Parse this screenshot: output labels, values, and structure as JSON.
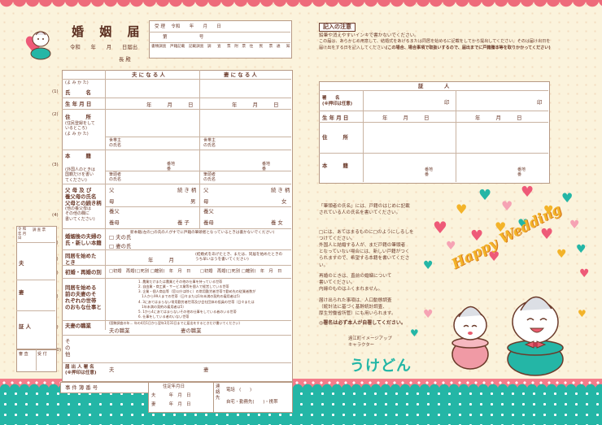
{
  "header": {
    "title": "婚 姻 届",
    "date_line": "令和　　年　　月　　日届出",
    "addressee": "長 殿"
  },
  "reception": {
    "row1": "受 理 　令和　　年　　月　　日",
    "row1b": "発 送　令和　　年　　月　　日",
    "row2": "第　　　　　　　号",
    "cols": [
      "書類調査",
      "戸籍記載",
      "記載調査",
      "調 査 票",
      "附　　票",
      "住 民 票",
      "通　知"
    ]
  },
  "rows": {
    "furigana": "(よ み か た)",
    "husband": "夫 に な る 人",
    "wife": "妻 に な る 人",
    "name": "氏　　　名",
    "birth": "生 年 月 日",
    "ymd": "年　　　月　　　日",
    "address": "住　　　所",
    "address_sub": "(住民登録をして\nいるところ)",
    "householder": "世帯主\nの氏名",
    "honseki": "本　　　籍",
    "honseki_sub": "(外国人のときは\n国籍だけを書い\nてください)",
    "banchi": "番地\n番",
    "hittou": "筆頭者\nの氏名",
    "parents": "父 母 及 び\n養父母の氏名\n父母との続き柄",
    "parents_sub": "(他の養父母は\nその他の欄に\n書いてください)",
    "father": "父",
    "mother": "母",
    "adopt_f": "養父",
    "adopt_m": "養母",
    "rel": "続 き 柄",
    "son": "男",
    "daughter": "女",
    "adopt_son": "養 子",
    "adopt_dau": "養 女",
    "new_name": "婚姻後の夫婦の\n氏・新しい本籍",
    "new_name_opt": "□ 夫の氏\n□ 妻の氏",
    "new_name_note": "新本籍(左の□の氏の人がすでに戸籍の筆頭者となっているときは書かないでください)",
    "cohab": "同居を始めた\nとき",
    "cohab_val": "年　　　月",
    "cohab_note": "(結婚式をあげたとき、または、同居を始めたときの\nうち早いほうを書いてください)",
    "prev": "初婚・再婚の別",
    "prev_val": "□初婚　再婚(□死別 □離別)　年　月　日",
    "work": "同居を始める\n前の夫妻のそ\nれぞれの世帯\nのおもな仕事と",
    "work_items": [
      "1. 農業だけまたは農業とその他の仕事を持っている世帯",
      "2. 自由業・商工業・サービス業等を個人で経営している世帯",
      "3. 企業・個人商店等（官公庁は除く）の常用勤労者世帯で勤め先の従業者数が",
      "　1人から99人までの世帯（日々または1年未満の契約の雇用者は5）",
      "4. 3にあてはまらない常用勤労者世帯及び会社団体の役員の世帯（日々または",
      "　1年未満の契約の雇用者は5）",
      "5. 1から4にあてはまらないその他の仕事をしている者のいる世帯",
      "6. 仕事をしている者のいない世帯"
    ],
    "job": "夫妻の職業",
    "job_sub": "(国勢調査の年… 年の4月1日から翌年3月31日までに届出をするときだけ書いてください)",
    "job_h": "夫の職業",
    "job_w": "妻の職業",
    "other": "そ\nの\n他",
    "signature": "届 出 人 署 名\n(※押印は任意)",
    "sig_h": "夫",
    "sig_w": "妻",
    "doc_no": "事 件 簿 番 号",
    "resident": "住定年月日",
    "h_row": "夫　　　年　月　日",
    "w_row": "妻　　　年　月　日",
    "contact": "連\n絡\n先",
    "phone": "電話　(　　)",
    "home": "自宅・勤務先(　　)・携帯"
  },
  "left_side": {
    "col_header": "令 和\n年 月\n日",
    "recv": "調 査 票",
    "row_labels": [
      "夫",
      "妻",
      "証 人"
    ],
    "nums": [
      "(1)",
      "(2)",
      "(3)",
      "(4)",
      "(5)",
      "(6)",
      "(7)",
      "(8)",
      "(9)",
      "(10)"
    ],
    "bottom": [
      "審 査",
      "受 付"
    ]
  },
  "notice": {
    "title": "記入の注意",
    "lines": [
      "鉛筆や消えやすいインキで書かないでください。",
      "この届は、あらかじめ用意して、結婚式をあげるまたは同居を始めるに記載をしてから提出してください。そのは届け出日を",
      "届け出をする日を記入してください。",
      "(この場合、場合事項で取扱いするので、届出までに戸籍謄本等を取りかかってください)"
    ]
  },
  "witness": {
    "title": "証　　　　人",
    "sign": "署　　名\n(※押印は任意)",
    "seal": "印",
    "birth": "生 年 月 日",
    "ymd": "年　　　月　　　日",
    "address": "住　　　所",
    "honseki": "本　　　籍",
    "banchi1": "番地\n番",
    "banchi2": "番地\n番"
  },
  "side_notes": {
    "n1": "「筆頭者の氏名」には、戸籍のはじめに記載\nされている人の氏名を書いてください。",
    "n2": "□には、あてはまるものに□のようにしるしを\nつけてください。\n外国人と結婚する人が、まだ戸籍の筆頭者\nとなっていない場合には、新しい戸籍がつく\nられますので、希望する本籍を書いてくださ\nい。",
    "n3": "再婚のときは、直前の婚姻について\n書いてください。\n内縁のものはふくまれません。",
    "n4": "届け出られた事項は、人口動態調査\n（統計法に基づく基幹統計調査、\n厚生労働省所管）にも用いられます。",
    "n5": "◎署名は必ず本人が自署してください。"
  },
  "branding": {
    "wedding": "Happy Wedding",
    "tagline": "遠江町イメージアップ\nキャラクター",
    "mascot": "うけどん"
  },
  "colors": {
    "pink": "#ee6b7b",
    "teal": "#24b6a6",
    "brown": "#6b3a2a",
    "cream": "#fbf3dc"
  }
}
